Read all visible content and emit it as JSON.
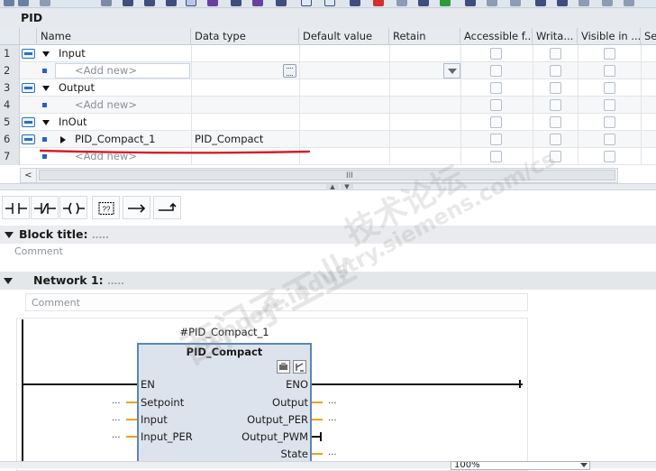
{
  "block": {
    "name": "PID"
  },
  "columns": [
    "Name",
    "Data type",
    "Default value",
    "Retain",
    "Accessible f...",
    "Writa...",
    "Visible in ...",
    "Se"
  ],
  "rows": [
    {
      "num": "1",
      "kind": "section",
      "name": "Input",
      "type": ""
    },
    {
      "num": "2",
      "kind": "addnew",
      "name": "<Add new>",
      "type": "",
      "editing": true
    },
    {
      "num": "3",
      "kind": "section",
      "name": "Output",
      "type": ""
    },
    {
      "num": "4",
      "kind": "addnew",
      "name": "<Add new>",
      "type": ""
    },
    {
      "num": "5",
      "kind": "section",
      "name": "InOut",
      "type": ""
    },
    {
      "num": "6",
      "kind": "variable",
      "name": "PID_Compact_1",
      "type": "PID_Compact"
    },
    {
      "num": "7",
      "kind": "addnew",
      "name": "<Add new>",
      "type": ""
    }
  ],
  "scroll": {
    "left_arrow": "<",
    "grip": "III"
  },
  "lad_toolbar": [
    "normally-open-contact",
    "normally-closed-contact",
    "output-coil",
    "empty-box",
    "open-branch",
    "close-branch"
  ],
  "lad_toolbar_glyphs": {
    "empty_box": "??"
  },
  "block_title": {
    "label": "Block title:",
    "dots": ".....",
    "comment": "Comment"
  },
  "network": {
    "label": "Network 1:",
    "dots": ".....",
    "comment": "Comment"
  },
  "function_block": {
    "instance": "#PID_Compact_1",
    "type": "PID_Compact",
    "inputs": [
      "EN",
      "Setpoint",
      "Input",
      "Input_PER"
    ],
    "outputs": [
      "ENO",
      "Output",
      "Output_PER",
      "Output_PWM",
      "State"
    ],
    "placeholder": "..."
  },
  "zoom": {
    "value": "100%"
  },
  "colors": {
    "accent": "#2a6fbd",
    "annotation": "#d81e2a",
    "pin": "#f2a100",
    "block_fill": "#dde3ec"
  },
  "watermark": [
    "西门子工业",
    "support.industry.siemens.com/cs",
    "技术论坛"
  ]
}
